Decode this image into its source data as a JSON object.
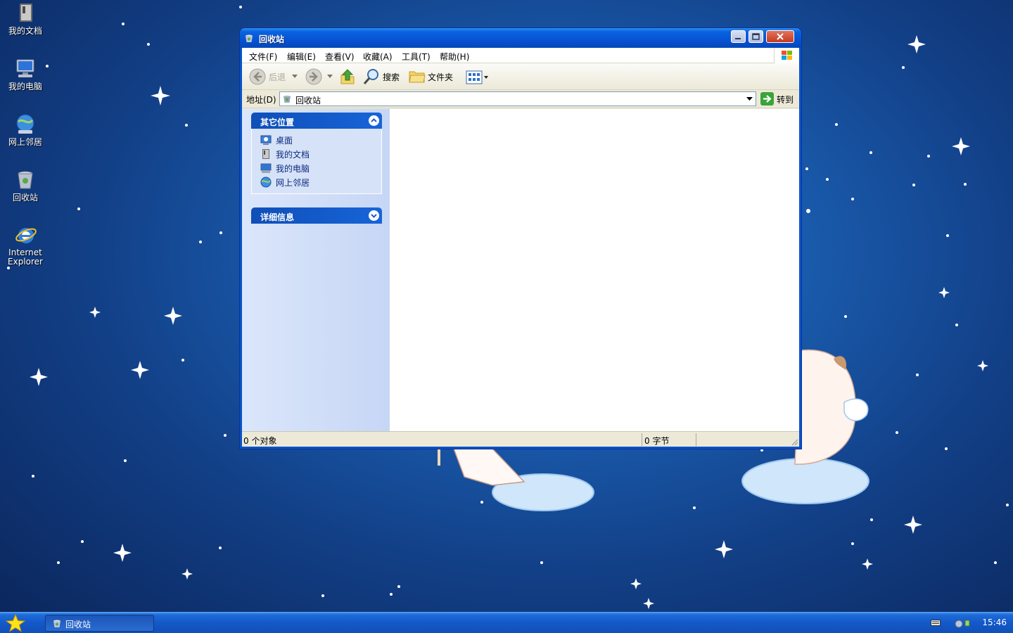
{
  "desktop": {
    "icons": [
      {
        "label": "我的文档"
      },
      {
        "label": "我的电脑"
      },
      {
        "label": "网上邻居"
      },
      {
        "label": "回收站"
      },
      {
        "label_line1": "Internet",
        "label_line2": "Explorer"
      }
    ]
  },
  "window": {
    "title": "回收站",
    "menu": [
      "文件(F)",
      "编辑(E)",
      "查看(V)",
      "收藏(A)",
      "工具(T)",
      "帮助(H)"
    ],
    "toolbar": {
      "back_label": "后退",
      "search_label": "搜索",
      "folders_label": "文件夹"
    },
    "address": {
      "label": "地址(D)",
      "value": "回收站",
      "go_label": "转到"
    },
    "taskpane": {
      "other_places_title": "其它位置",
      "other_places": [
        "桌面",
        "我的文档",
        "我的电脑",
        "网上邻居"
      ],
      "details_title": "详细信息"
    },
    "status": {
      "objects": "0 个对象",
      "size": "0 字节"
    }
  },
  "taskbar": {
    "task_label": "回收站",
    "clock": "15:46"
  },
  "colors": {
    "title_blue": "#0653d4",
    "taskbar_blue": "#1458c8",
    "pane_header": "#1764d8"
  }
}
